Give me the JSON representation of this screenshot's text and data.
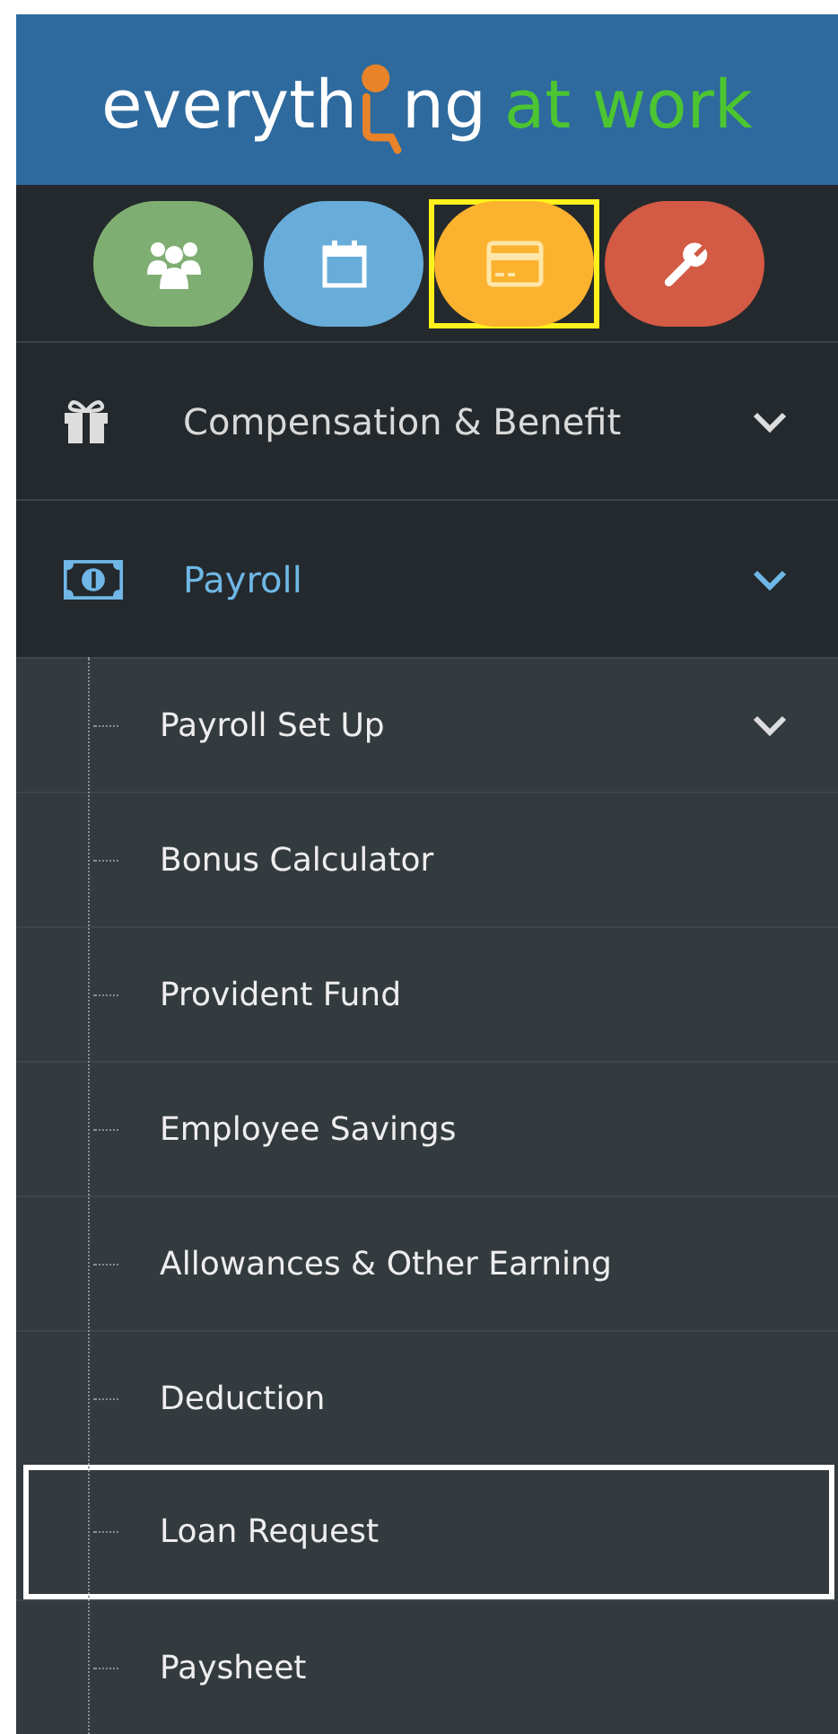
{
  "logo": {
    "part_1": "everyth",
    "part_2": "ng",
    "part_3": "at work"
  },
  "module_buttons": [
    {
      "kind": "people",
      "color": "#7fae72",
      "highlighted": false
    },
    {
      "kind": "calendar",
      "color": "#68acd9",
      "highlighted": false
    },
    {
      "kind": "card",
      "color": "#fbb22e",
      "highlighted": true
    },
    {
      "kind": "wrench",
      "color": "#d35a44",
      "highlighted": false
    }
  ],
  "menu": [
    {
      "kind": "gift",
      "label": "Compensation & Benefit",
      "selected": false
    },
    {
      "kind": "money",
      "label": "Payroll",
      "selected": true,
      "children": [
        {
          "label": "Payroll Set Up",
          "expandable": true,
          "highlighted": false
        },
        {
          "label": "Bonus Calculator",
          "expandable": false,
          "highlighted": false
        },
        {
          "label": "Provident Fund",
          "expandable": false,
          "highlighted": false
        },
        {
          "label": "Employee Savings",
          "expandable": false,
          "highlighted": false
        },
        {
          "label": "Allowances & Other Earning",
          "expandable": false,
          "highlighted": false
        },
        {
          "label": "Deduction",
          "expandable": false,
          "highlighted": false
        },
        {
          "label": "Loan Request",
          "expandable": false,
          "highlighted": true
        },
        {
          "label": "Paysheet",
          "expandable": false,
          "highlighted": false
        }
      ]
    }
  ]
}
